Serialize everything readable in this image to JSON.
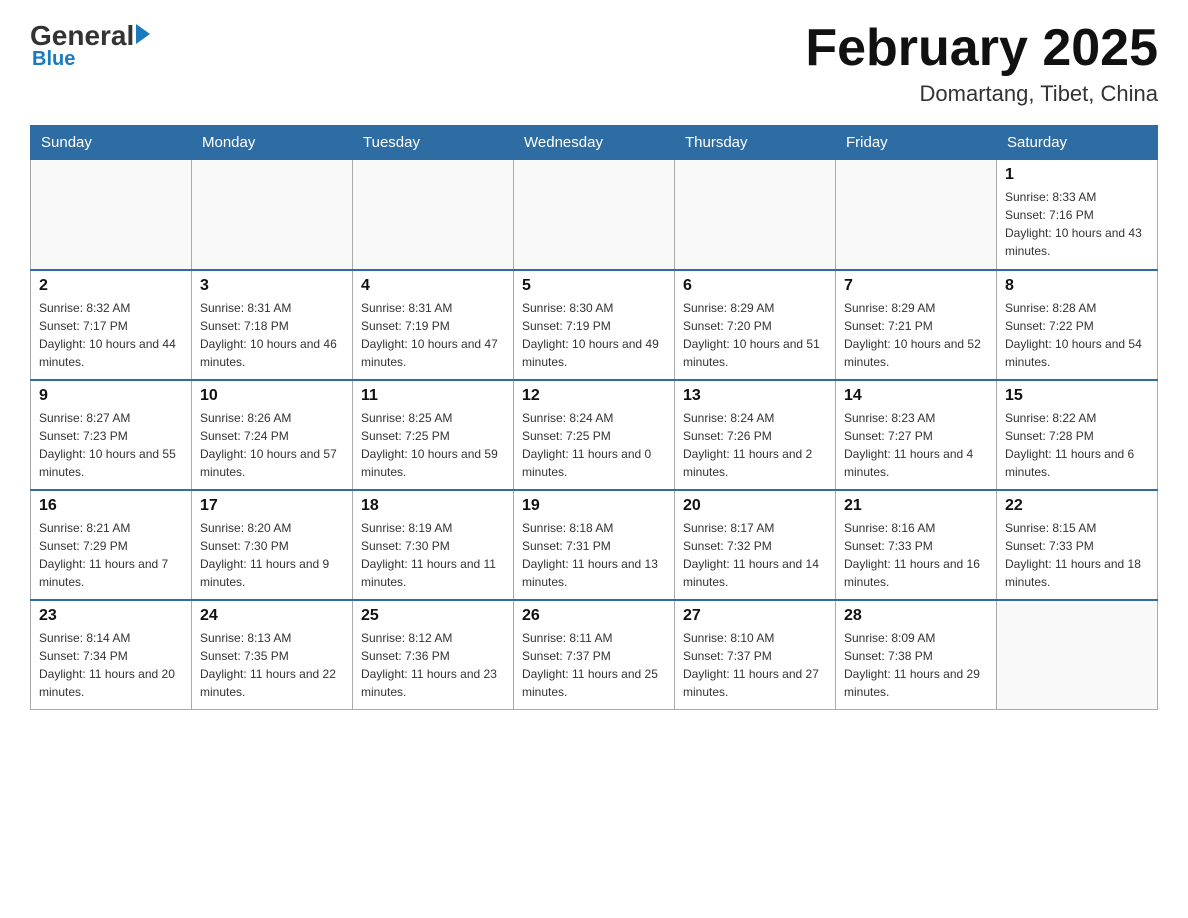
{
  "header": {
    "logo_general": "General",
    "logo_blue": "Blue",
    "month_title": "February 2025",
    "location": "Domartang, Tibet, China"
  },
  "weekdays": [
    "Sunday",
    "Monday",
    "Tuesday",
    "Wednesday",
    "Thursday",
    "Friday",
    "Saturday"
  ],
  "weeks": [
    [
      {
        "day": "",
        "info": ""
      },
      {
        "day": "",
        "info": ""
      },
      {
        "day": "",
        "info": ""
      },
      {
        "day": "",
        "info": ""
      },
      {
        "day": "",
        "info": ""
      },
      {
        "day": "",
        "info": ""
      },
      {
        "day": "1",
        "info": "Sunrise: 8:33 AM\nSunset: 7:16 PM\nDaylight: 10 hours and 43 minutes."
      }
    ],
    [
      {
        "day": "2",
        "info": "Sunrise: 8:32 AM\nSunset: 7:17 PM\nDaylight: 10 hours and 44 minutes."
      },
      {
        "day": "3",
        "info": "Sunrise: 8:31 AM\nSunset: 7:18 PM\nDaylight: 10 hours and 46 minutes."
      },
      {
        "day": "4",
        "info": "Sunrise: 8:31 AM\nSunset: 7:19 PM\nDaylight: 10 hours and 47 minutes."
      },
      {
        "day": "5",
        "info": "Sunrise: 8:30 AM\nSunset: 7:19 PM\nDaylight: 10 hours and 49 minutes."
      },
      {
        "day": "6",
        "info": "Sunrise: 8:29 AM\nSunset: 7:20 PM\nDaylight: 10 hours and 51 minutes."
      },
      {
        "day": "7",
        "info": "Sunrise: 8:29 AM\nSunset: 7:21 PM\nDaylight: 10 hours and 52 minutes."
      },
      {
        "day": "8",
        "info": "Sunrise: 8:28 AM\nSunset: 7:22 PM\nDaylight: 10 hours and 54 minutes."
      }
    ],
    [
      {
        "day": "9",
        "info": "Sunrise: 8:27 AM\nSunset: 7:23 PM\nDaylight: 10 hours and 55 minutes."
      },
      {
        "day": "10",
        "info": "Sunrise: 8:26 AM\nSunset: 7:24 PM\nDaylight: 10 hours and 57 minutes."
      },
      {
        "day": "11",
        "info": "Sunrise: 8:25 AM\nSunset: 7:25 PM\nDaylight: 10 hours and 59 minutes."
      },
      {
        "day": "12",
        "info": "Sunrise: 8:24 AM\nSunset: 7:25 PM\nDaylight: 11 hours and 0 minutes."
      },
      {
        "day": "13",
        "info": "Sunrise: 8:24 AM\nSunset: 7:26 PM\nDaylight: 11 hours and 2 minutes."
      },
      {
        "day": "14",
        "info": "Sunrise: 8:23 AM\nSunset: 7:27 PM\nDaylight: 11 hours and 4 minutes."
      },
      {
        "day": "15",
        "info": "Sunrise: 8:22 AM\nSunset: 7:28 PM\nDaylight: 11 hours and 6 minutes."
      }
    ],
    [
      {
        "day": "16",
        "info": "Sunrise: 8:21 AM\nSunset: 7:29 PM\nDaylight: 11 hours and 7 minutes."
      },
      {
        "day": "17",
        "info": "Sunrise: 8:20 AM\nSunset: 7:30 PM\nDaylight: 11 hours and 9 minutes."
      },
      {
        "day": "18",
        "info": "Sunrise: 8:19 AM\nSunset: 7:30 PM\nDaylight: 11 hours and 11 minutes."
      },
      {
        "day": "19",
        "info": "Sunrise: 8:18 AM\nSunset: 7:31 PM\nDaylight: 11 hours and 13 minutes."
      },
      {
        "day": "20",
        "info": "Sunrise: 8:17 AM\nSunset: 7:32 PM\nDaylight: 11 hours and 14 minutes."
      },
      {
        "day": "21",
        "info": "Sunrise: 8:16 AM\nSunset: 7:33 PM\nDaylight: 11 hours and 16 minutes."
      },
      {
        "day": "22",
        "info": "Sunrise: 8:15 AM\nSunset: 7:33 PM\nDaylight: 11 hours and 18 minutes."
      }
    ],
    [
      {
        "day": "23",
        "info": "Sunrise: 8:14 AM\nSunset: 7:34 PM\nDaylight: 11 hours and 20 minutes."
      },
      {
        "day": "24",
        "info": "Sunrise: 8:13 AM\nSunset: 7:35 PM\nDaylight: 11 hours and 22 minutes."
      },
      {
        "day": "25",
        "info": "Sunrise: 8:12 AM\nSunset: 7:36 PM\nDaylight: 11 hours and 23 minutes."
      },
      {
        "day": "26",
        "info": "Sunrise: 8:11 AM\nSunset: 7:37 PM\nDaylight: 11 hours and 25 minutes."
      },
      {
        "day": "27",
        "info": "Sunrise: 8:10 AM\nSunset: 7:37 PM\nDaylight: 11 hours and 27 minutes."
      },
      {
        "day": "28",
        "info": "Sunrise: 8:09 AM\nSunset: 7:38 PM\nDaylight: 11 hours and 29 minutes."
      },
      {
        "day": "",
        "info": ""
      }
    ]
  ]
}
